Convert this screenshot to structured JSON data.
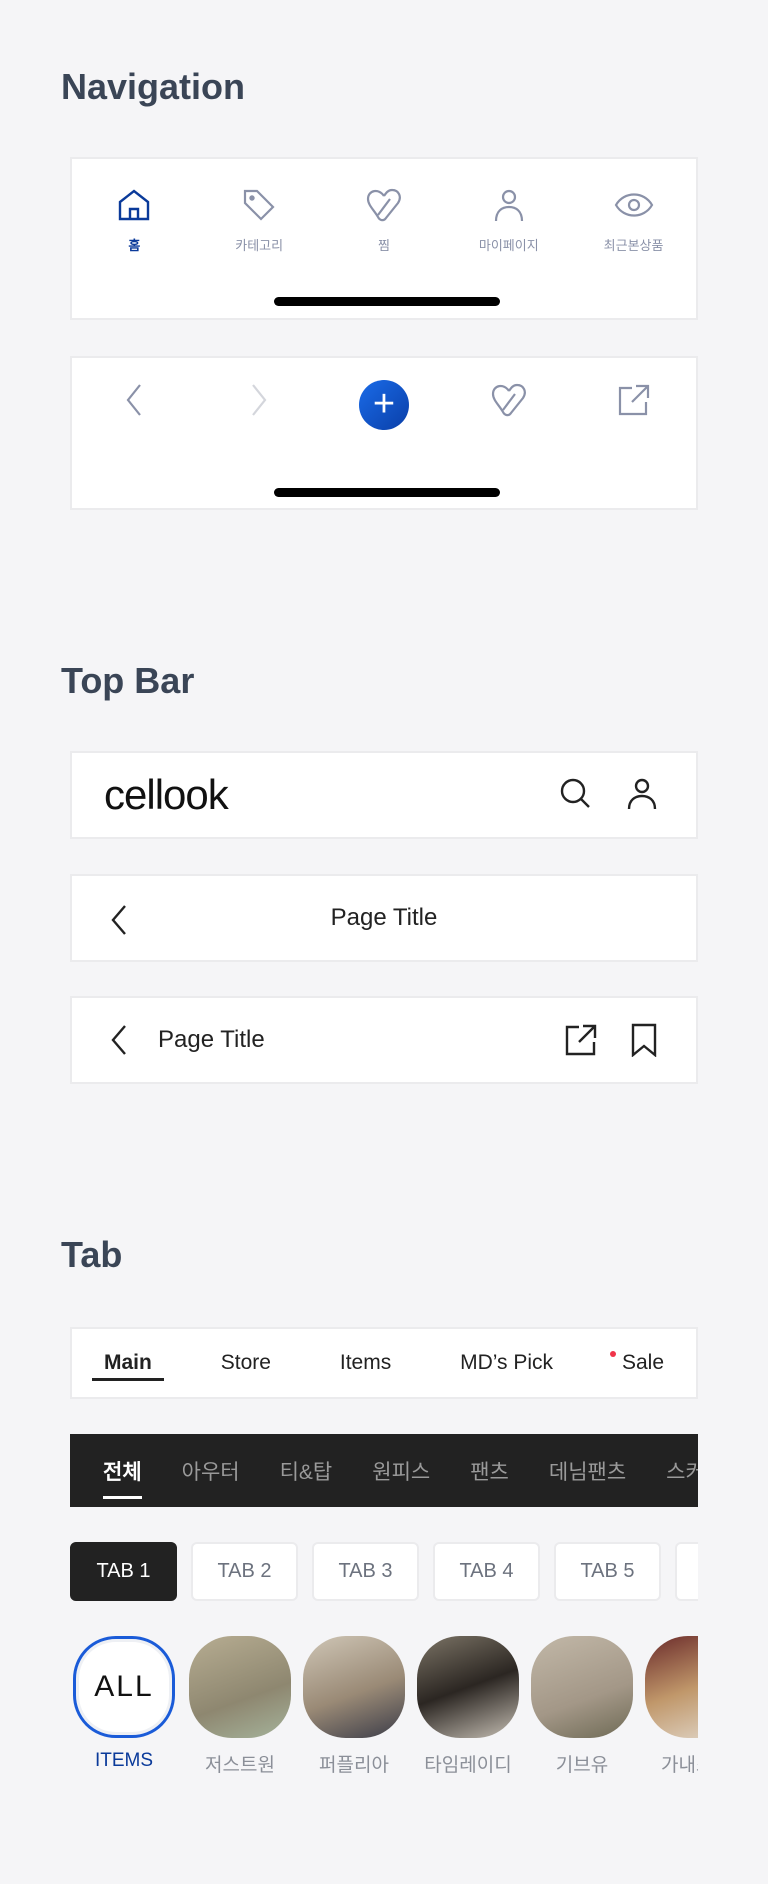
{
  "sections": {
    "navigation": "Navigation",
    "topbar": "Top Bar",
    "tab": "Tab"
  },
  "bottom_nav": {
    "items": [
      {
        "label": "홈",
        "icon": "home-icon",
        "active": true
      },
      {
        "label": "카테고리",
        "icon": "tag-icon"
      },
      {
        "label": "찜",
        "icon": "heart-icon"
      },
      {
        "label": "마이페이지",
        "icon": "user-icon"
      },
      {
        "label": "최근본상품",
        "icon": "eye-icon"
      }
    ]
  },
  "browser_nav": {
    "plus": "+"
  },
  "topbars": {
    "logo": "cellook",
    "title_center": "Page Title",
    "title_left": "Page Title"
  },
  "tabs_text": [
    {
      "label": "Main",
      "active": true
    },
    {
      "label": "Store"
    },
    {
      "label": "Items"
    },
    {
      "label": "MD’s Pick"
    },
    {
      "label": "Sale",
      "dot": true
    }
  ],
  "tabs_dark": [
    {
      "label": "전체",
      "active": true
    },
    {
      "label": "아우터"
    },
    {
      "label": "티&탑"
    },
    {
      "label": "원피스"
    },
    {
      "label": "팬츠"
    },
    {
      "label": "데님팬츠"
    },
    {
      "label": "스커트"
    }
  ],
  "chips": [
    {
      "label": "TAB 1",
      "active": true
    },
    {
      "label": "TAB 2"
    },
    {
      "label": "TAB 3"
    },
    {
      "label": "TAB 4"
    },
    {
      "label": "TAB 5"
    },
    {
      "label": ""
    }
  ],
  "stores": {
    "all_label": "ALL",
    "all_caption": "ITEMS",
    "items": [
      {
        "label": "저스트원"
      },
      {
        "label": "퍼플리아"
      },
      {
        "label": "타임레이디"
      },
      {
        "label": "기브유"
      },
      {
        "label": "가내스라"
      }
    ]
  },
  "colors": {
    "accent": "#0a3a9a",
    "blue": "#1a6be8",
    "inactive": "#8a91a8"
  }
}
